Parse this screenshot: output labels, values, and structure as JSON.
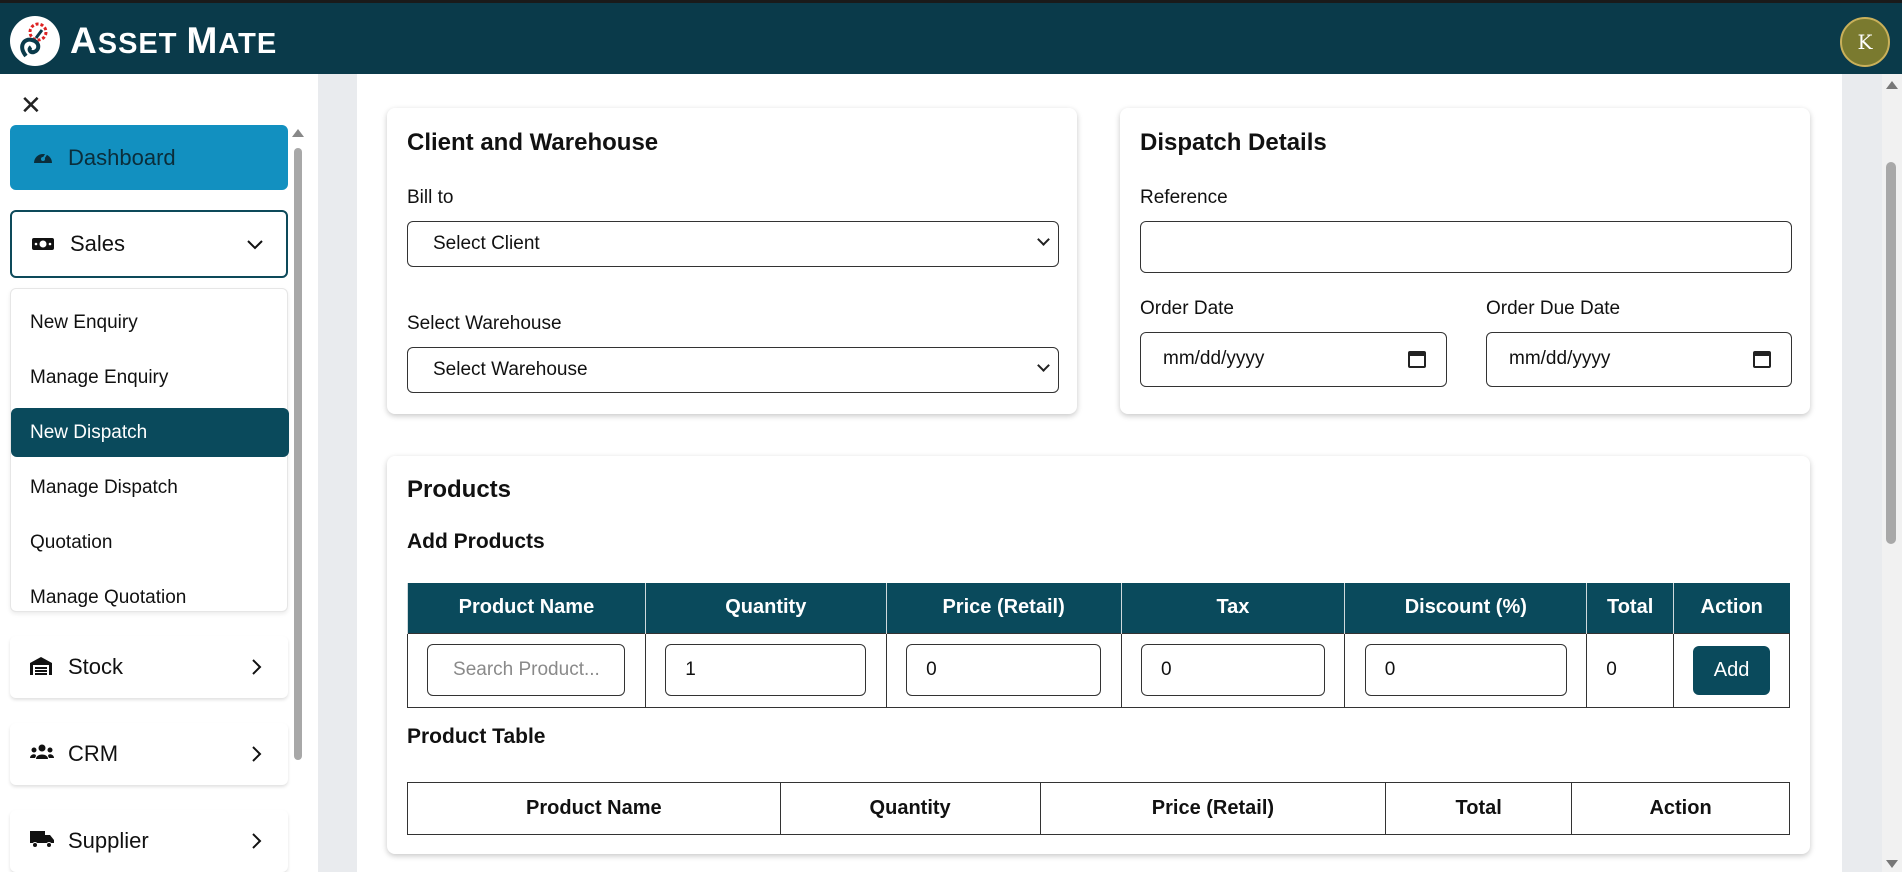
{
  "app": {
    "brand_first": "A",
    "brand_rest1": "SSET ",
    "brand_second": "M",
    "brand_rest2": "ATE",
    "avatar_initial": "K"
  },
  "sidebar": {
    "dashboard": "Dashboard",
    "sales": "Sales",
    "sales_items": [
      "New Enquiry",
      "Manage Enquiry",
      "New Dispatch",
      "Manage Dispatch",
      "Quotation",
      "Manage Quotation"
    ],
    "active_item": "New Dispatch",
    "stock": "Stock",
    "crm": "CRM",
    "supplier": "Supplier"
  },
  "client_card": {
    "title": "Client and Warehouse",
    "bill_to_label": "Bill to",
    "client_select_value": "Select Client",
    "warehouse_label": "Select Warehouse",
    "warehouse_select_value": "Select Warehouse"
  },
  "dispatch_card": {
    "title": "Dispatch Details",
    "reference_label": "Reference",
    "reference_value": "",
    "order_date_label": "Order Date",
    "order_date_value": "mm/dd/yyyy",
    "due_date_label": "Order Due Date",
    "due_date_value": "mm/dd/yyyy"
  },
  "products": {
    "title": "Products",
    "add_title": "Add Products",
    "columns": [
      "Product Name",
      "Quantity",
      "Price (Retail)",
      "Tax",
      "Discount (%)",
      "Total",
      "Action"
    ],
    "row": {
      "product_placeholder": "Search Product...",
      "quantity": "1",
      "price": "0",
      "tax": "0",
      "discount": "0",
      "total": "0",
      "action": "Add"
    },
    "table_title": "Product Table",
    "table_columns": [
      "Product Name",
      "Quantity",
      "Price (Retail)",
      "Total",
      "Action"
    ]
  }
}
